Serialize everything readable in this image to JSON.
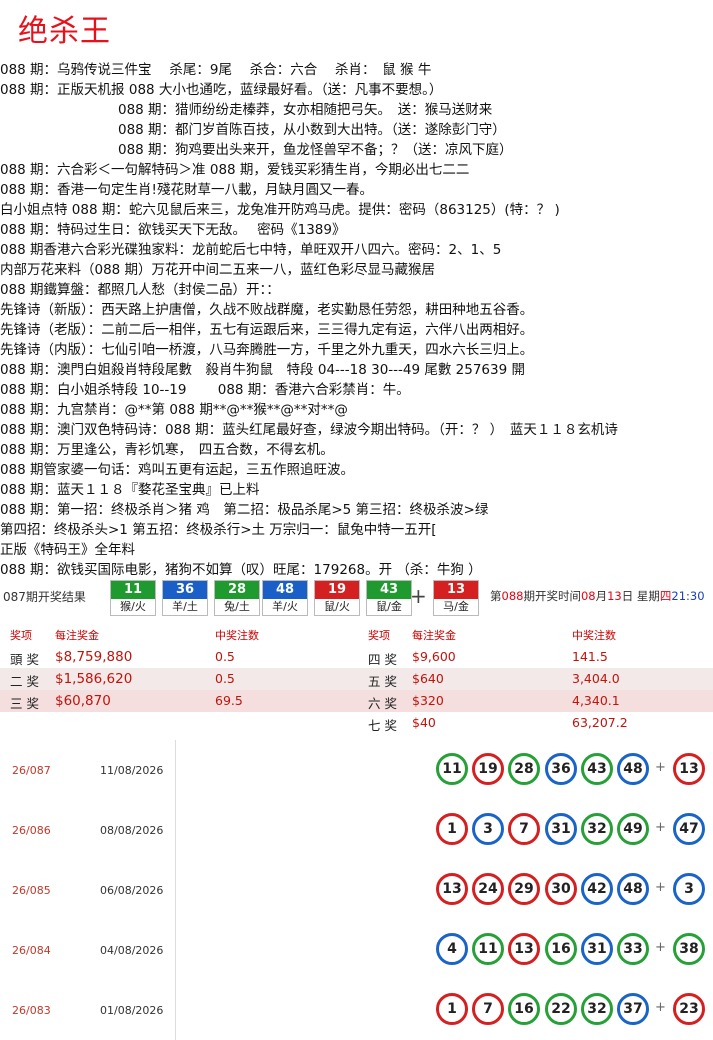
{
  "title": "绝杀王",
  "lines": [
    "088 期：乌鸦传说三件宝　 杀尾：9尾　 杀合：六合　 杀肖：　鼠 猴 牛",
    "088 期：正版天机报 088 大小也通吃，蓝绿最好看。（送：凡事不要想。）",
    "088 期：猎师纷纷走榛莽，女亦相随把弓矢。　送：猴马送财来",
    "088 期：都门岁首陈百技，从小数到大出特。（送：遂除彭门守）",
    "088 期：狗鸡要出头来开，鱼龙怪兽罕不备；？（送：凉风下庭）",
    "088 期：六合彩＜一句解特码＞准 088 期，爱钱买彩猜生肖，今期必出七二二",
    "088 期：香港一句定生肖!殘花財草一八載，月缺月圓又一春。",
    "白小姐点特 088 期：蛇六见鼠后来三，龙兔准开防鸡马虎。提供：密码（863125）(特：？ )",
    "088 期：特码过生日：欲钱买天下无敌。　 密码《1389》",
    "088 期香港六合彩光碟独家料：龙前蛇后七中特，单旺双开八四六。密码：2、1、5",
    "内部万花来料（088 期）万花开中间二五来一八，蓝红色彩尽显马藏猴居",
    "088 期鐵算盤：都照几人愁（封侯二品）开：：",
    "先锋诗（新版）：西天路上护唐僧，久战不败战群魔，老实勤恳任劳怨，耕田种地五谷香。",
    "先锋诗（老版）：二前二后一相伴，五七有运跟后来，三三得九定有运，六伴八出两相好。",
    "先锋诗（内版）：七仙引咱一桥渡，八马奔腾胜一方，千里之外九重天，四水六长三归上。",
    "088 期：澳門白姐殺肖特段尾數　殺肖牛狗鼠　特段 04---18 30---49 尾數 257639 開",
    "088 期：白小姐杀特段 10--19　　 088 期：香港六合彩禁肖：牛。",
    "088 期：九宫禁肖：@**第 088 期**@**猴**@**对**@",
    "088 期：澳门双色特码诗：088 期：蓝头红尾最好查，绿波今期出特码。（开：？ ）　蓝天１１８玄机诗",
    "088 期：万里逢公，青衫饥寒，　四五合数，不得玄机。",
    "088 期管家婆一句话：鸡叫五更有运起，三五作照追旺波。",
    "088 期：蓝天１１８『婺花圣宝典』已上料",
    "088 期：第一招：终极杀肖＞猪 鸡　第二招：极品杀尾>5 第三招：终极杀波>绿",
    "第四招：终极杀头>1 第五招：终极杀行>土 万宗归一：鼠兔中特一五开[",
    "正版《特码王》全年料",
    "088 期：欲钱买国际电影，猪狗不如算（叹）旺尾：179268。开 （杀：牛狗 ）"
  ],
  "result": {
    "label": "087期开奖结果",
    "balls": [
      {
        "num": "11",
        "zodiac": "猴/火",
        "color": "#1f9a2e"
      },
      {
        "num": "36",
        "zodiac": "羊/土",
        "color": "#1a5fc8"
      },
      {
        "num": "28",
        "zodiac": "兔/土",
        "color": "#1f9a2e"
      },
      {
        "num": "48",
        "zodiac": "羊/火",
        "color": "#1a5fc8"
      },
      {
        "num": "19",
        "zodiac": "鼠/火",
        "color": "#d42020"
      },
      {
        "num": "43",
        "zodiac": "鼠/金",
        "color": "#1f9a2e"
      }
    ],
    "plus": "+",
    "special": {
      "num": "13",
      "zodiac": "马/金",
      "color": "#d42020"
    },
    "next_prefix": "第",
    "next_issue": "088",
    "next_mid": "期开奖时间",
    "month": "08",
    "month_unit": "月",
    "day": "13",
    "day_unit": "日",
    "week_prefix": "星期",
    "week_day": "四",
    "time": "21:30"
  },
  "prize": {
    "headers": [
      "奖项",
      "每注奖金",
      "中奖注数",
      "奖项",
      "每注奖金",
      "中奖注数"
    ],
    "rows": [
      {
        "a": "頭 奖",
        "b": "$8,759,880",
        "c": "0.5",
        "d": "四 奖",
        "e": "$9,600",
        "f": "141.5"
      },
      {
        "a": "二 奖",
        "b": "$1,586,620",
        "c": "0.5",
        "d": "五 奖",
        "e": "$640",
        "f": "3,404.0"
      },
      {
        "a": "三 奖",
        "b": "$60,870",
        "c": "69.5",
        "d": "六 奖",
        "e": "$320",
        "f": "4,340.1"
      },
      {
        "a": "",
        "b": "",
        "c": "",
        "d": "七 奖",
        "e": "$40",
        "f": "63,207.2"
      }
    ]
  },
  "history": [
    {
      "issue": "26/087",
      "date": "11/08/2026",
      "balls": [
        {
          "n": "11",
          "c": "green"
        },
        {
          "n": "19",
          "c": "red"
        },
        {
          "n": "28",
          "c": "green"
        },
        {
          "n": "36",
          "c": "blue"
        },
        {
          "n": "43",
          "c": "green"
        },
        {
          "n": "48",
          "c": "blue"
        }
      ],
      "special": {
        "n": "13",
        "c": "red"
      }
    },
    {
      "issue": "26/086",
      "date": "08/08/2026",
      "balls": [
        {
          "n": "1",
          "c": "red"
        },
        {
          "n": "3",
          "c": "blue"
        },
        {
          "n": "7",
          "c": "red"
        },
        {
          "n": "31",
          "c": "blue"
        },
        {
          "n": "32",
          "c": "green"
        },
        {
          "n": "49",
          "c": "green"
        }
      ],
      "special": {
        "n": "47",
        "c": "blue"
      }
    },
    {
      "issue": "26/085",
      "date": "06/08/2026",
      "balls": [
        {
          "n": "13",
          "c": "red"
        },
        {
          "n": "24",
          "c": "red"
        },
        {
          "n": "29",
          "c": "red"
        },
        {
          "n": "30",
          "c": "red"
        },
        {
          "n": "42",
          "c": "blue"
        },
        {
          "n": "48",
          "c": "blue"
        }
      ],
      "special": {
        "n": "3",
        "c": "blue"
      }
    },
    {
      "issue": "26/084",
      "date": "04/08/2026",
      "balls": [
        {
          "n": "4",
          "c": "blue"
        },
        {
          "n": "11",
          "c": "green"
        },
        {
          "n": "13",
          "c": "red"
        },
        {
          "n": "16",
          "c": "green"
        },
        {
          "n": "31",
          "c": "blue"
        },
        {
          "n": "33",
          "c": "green"
        }
      ],
      "special": {
        "n": "38",
        "c": "green"
      }
    },
    {
      "issue": "26/083",
      "date": "01/08/2026",
      "balls": [
        {
          "n": "1",
          "c": "red"
        },
        {
          "n": "7",
          "c": "red"
        },
        {
          "n": "16",
          "c": "green"
        },
        {
          "n": "22",
          "c": "green"
        },
        {
          "n": "32",
          "c": "green"
        },
        {
          "n": "37",
          "c": "blue"
        }
      ],
      "special": {
        "n": "23",
        "c": "red"
      }
    }
  ],
  "history_plus": "+"
}
